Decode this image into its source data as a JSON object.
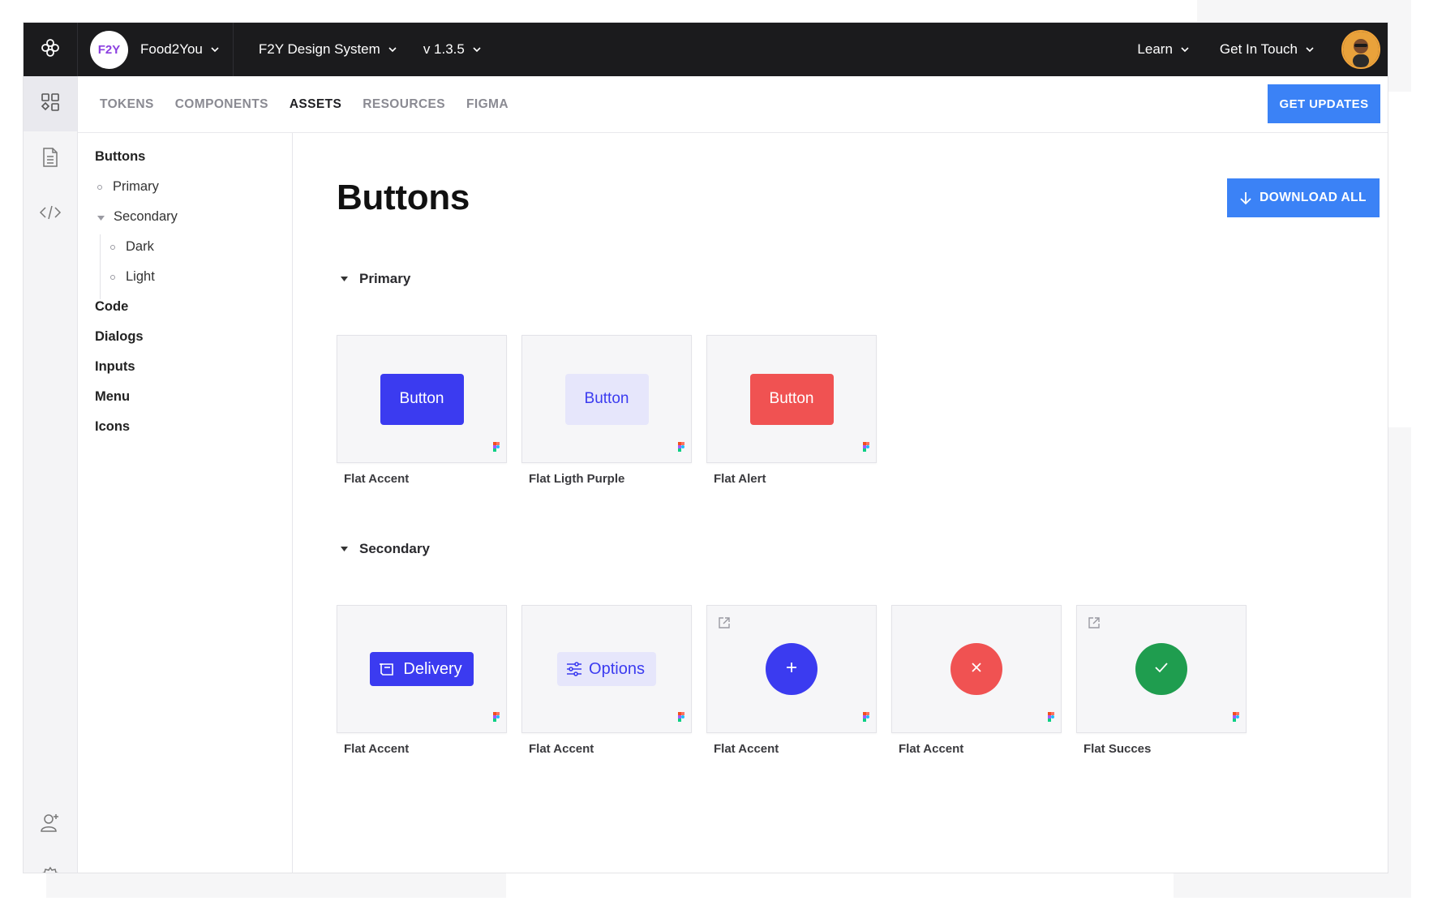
{
  "topbar": {
    "logo_icon": "network-flower-icon",
    "project_badge": "F2Y",
    "project_name": "Food2You",
    "design_system": "F2Y Design System",
    "version": "v 1.3.5",
    "learn": "Learn",
    "get_in_touch": "Get In Touch",
    "user_avatar": "user-avatar-photo"
  },
  "rail": {
    "items": [
      "grid-shapes-icon",
      "document-icon",
      "code-icon"
    ],
    "bottom": [
      "add-user-icon",
      "settings-gear-icon"
    ]
  },
  "subnav": {
    "tabs": [
      "TOKENS",
      "COMPONENTS",
      "ASSETS",
      "RESOURCES",
      "FIGMA"
    ],
    "active_tab": "ASSETS",
    "get_updates": "GET UPDATES"
  },
  "tree": {
    "buttons": "Buttons",
    "primary": "Primary",
    "secondary": "Secondary",
    "dark": "Dark",
    "light": "Light",
    "code": "Code",
    "dialogs": "Dialogs",
    "inputs": "Inputs",
    "menu": "Menu",
    "icons": "Icons"
  },
  "main": {
    "title": "Buttons",
    "download_all": "DOWNLOAD ALL",
    "primary_section": "Primary",
    "secondary_section": "Secondary",
    "primary_cards": [
      {
        "button_text": "Button",
        "label": "Flat Accent"
      },
      {
        "button_text": "Button",
        "label": "Flat Ligth Purple"
      },
      {
        "button_text": "Button",
        "label": "Flat Alert"
      }
    ],
    "secondary_cards": [
      {
        "button_text": "Delivery",
        "label": "Flat Accent"
      },
      {
        "button_text": "Options",
        "label": "Flat Accent"
      },
      {
        "label": "Flat Accent"
      },
      {
        "label": "Flat Accent"
      },
      {
        "label": "Flat Succes"
      }
    ]
  },
  "colors": {
    "topbar_bg": "#1b1b1d",
    "accent": "#3b3bf0",
    "light_purple": "#e6e6fb",
    "alert": "#f05252",
    "success": "#1f9d4f",
    "cta_blue": "#3b82f6"
  }
}
